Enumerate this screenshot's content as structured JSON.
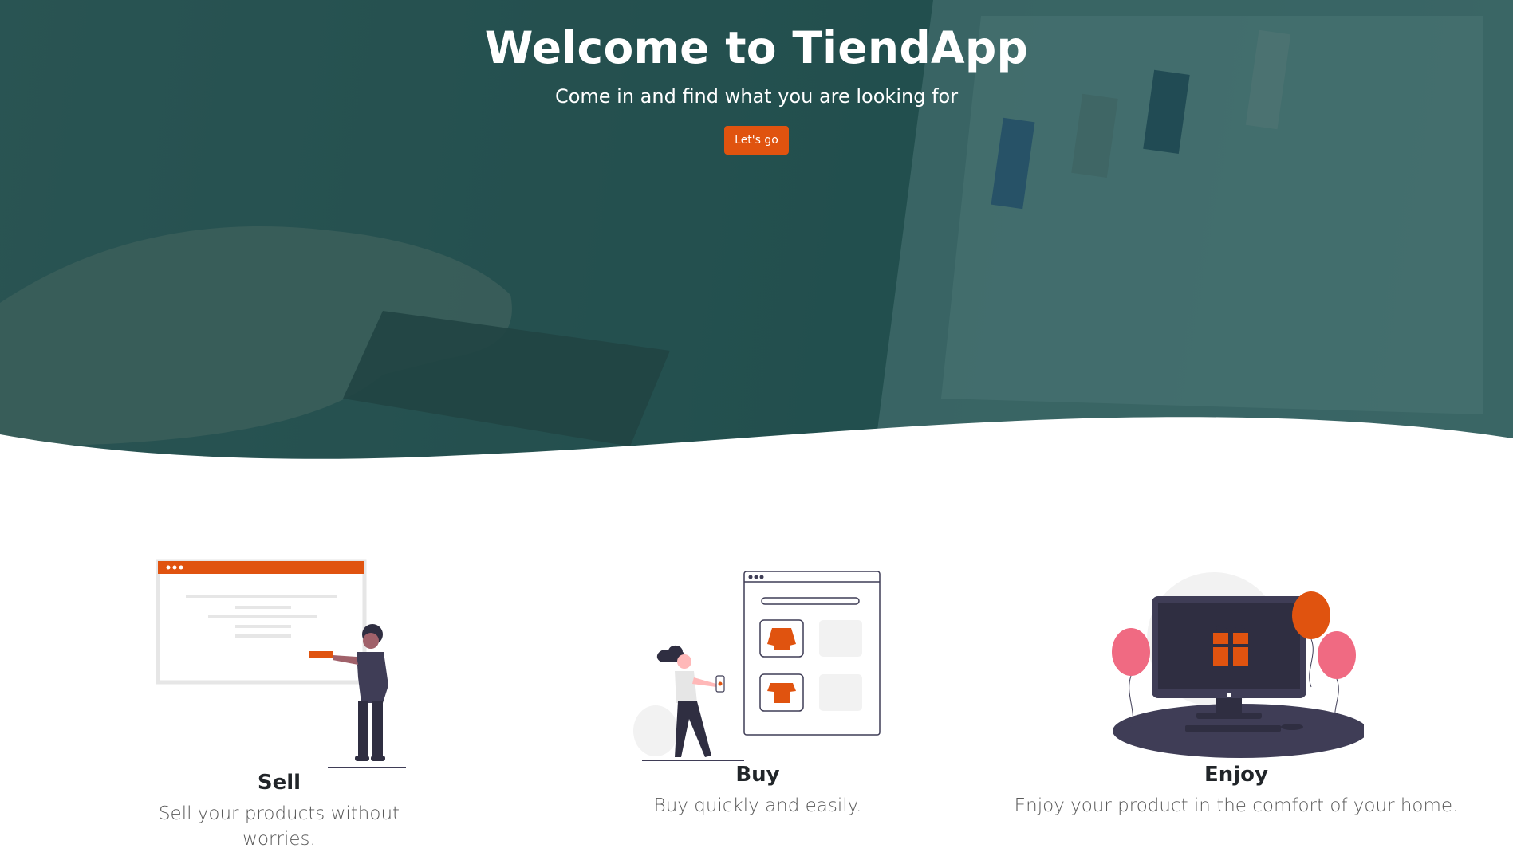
{
  "hero": {
    "title": "Welcome to TiendApp",
    "subtitle": "Come in and find what you are looking for",
    "button_label": "Let's go"
  },
  "features": [
    {
      "title": "Sell",
      "description": "Sell your products without worries."
    },
    {
      "title": "Buy",
      "description": "Buy quickly and easily."
    },
    {
      "title": "Enjoy",
      "description": "Enjoy your product in the comfort of your home."
    }
  ],
  "colors": {
    "accent": "#e0530f",
    "hero_overlay": "#2f5252",
    "dark_figure": "#3f3d56",
    "balloon_pink": "#f06a82"
  }
}
